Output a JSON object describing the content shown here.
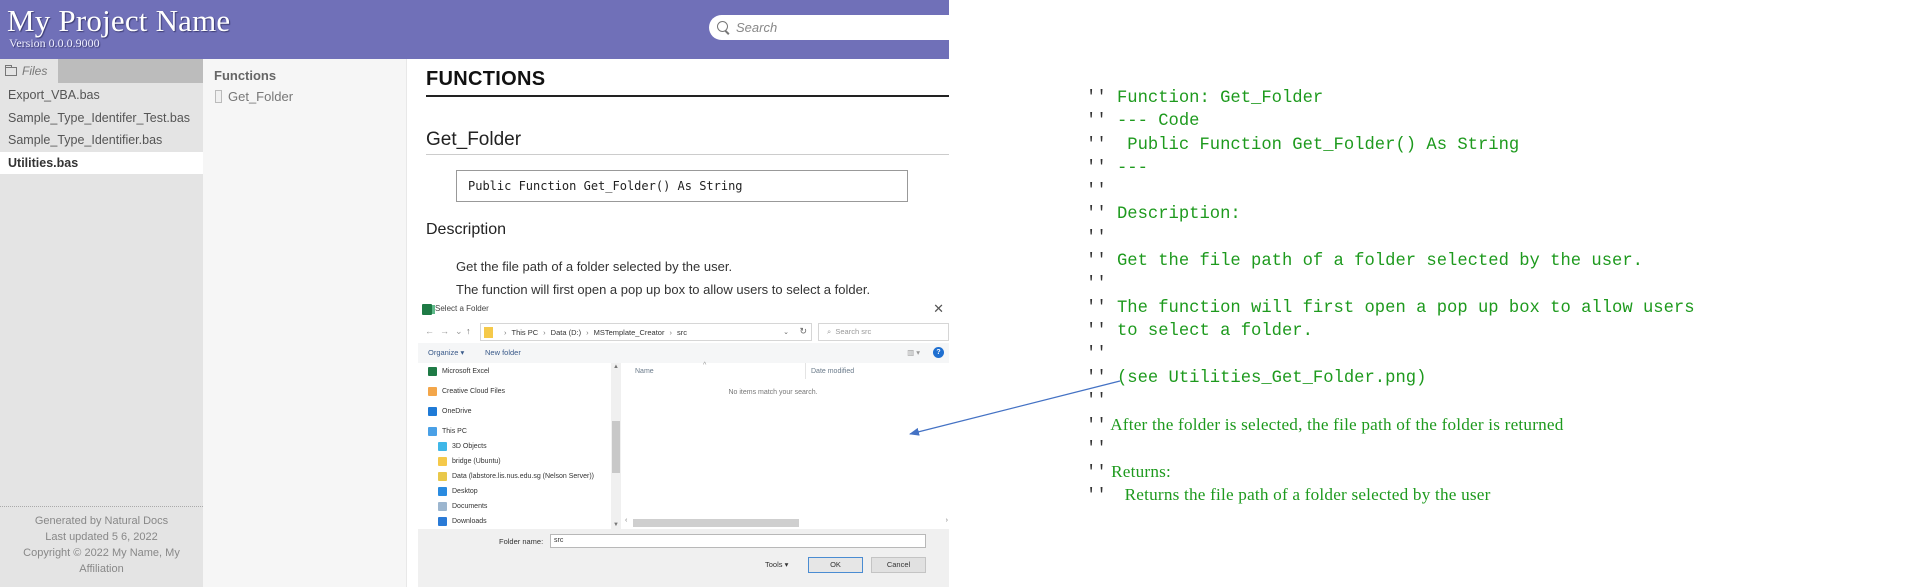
{
  "header": {
    "project_title": "My Project Name",
    "version": "Version 0.0.0.9000",
    "search_placeholder": "Search",
    "search_value": ""
  },
  "sidebar": {
    "tab_label": "Files",
    "files": [
      {
        "label": "Export_VBA.bas",
        "selected": false
      },
      {
        "label": "Sample_Type_Identifer_Test.bas",
        "selected": false
      },
      {
        "label": "Sample_Type_Identifier.bas",
        "selected": false
      },
      {
        "label": "Utilities.bas",
        "selected": true
      }
    ],
    "footer": {
      "generated_by": "Generated by Natural Docs",
      "last_updated": "Last updated 5 6, 2022",
      "copyright": "Copyright © 2022 My Name, My Affiliation"
    }
  },
  "summary": {
    "title": "Functions",
    "items": [
      "Get_Folder"
    ]
  },
  "content": {
    "section_title": "FUNCTIONS",
    "function_name": "Get_Folder",
    "prototype": "Public Function Get_Folder() As String",
    "description_heading": "Description",
    "description_paragraphs": [
      "Get the file path of a folder selected by the user.",
      "The function will first open a pop up box to allow users to select a folder."
    ],
    "dialog_image": {
      "title": "Select a Folder",
      "close": "✕",
      "nav": {
        "back": "←",
        "forward": "→",
        "recent": "⌄",
        "up": "↑"
      },
      "breadcrumb": [
        "This PC",
        "Data (D:)",
        "MSTemplate_Creator",
        "src"
      ],
      "address_dropdown": "⌄",
      "refresh": "↻",
      "search_placeholder": "Search src",
      "organize": "Organize ▾",
      "new_folder": "New folder",
      "view": "▥ ▾",
      "help": "?",
      "nav_items": [
        {
          "label": "Microsoft Excel",
          "icon": "excel-icon",
          "color": "#1e7a45"
        },
        {
          "label": "Creative Cloud Files",
          "icon": "creative-cloud-icon",
          "color": "#f3a64a"
        },
        {
          "label": "OneDrive",
          "icon": "onedrive-icon",
          "color": "#1f7ad6"
        },
        {
          "label": "This PC",
          "icon": "computer-icon",
          "color": "#4aa0e6"
        },
        {
          "label": "3D Objects",
          "icon": "3d-objects-icon",
          "color": "#3fb7e8"
        },
        {
          "label": "bridge (Ubuntu)",
          "icon": "folder-icon",
          "color": "#f5c94a"
        },
        {
          "label": "Data (labstore.lis.nus.edu.sg (Nelson Server))",
          "icon": "network-drive-icon",
          "color": "#e9c84a"
        },
        {
          "label": "Desktop",
          "icon": "desktop-icon",
          "color": "#2a8be0"
        },
        {
          "label": "Documents",
          "icon": "documents-icon",
          "color": "#9cb6cf"
        },
        {
          "label": "Downloads",
          "icon": "downloads-icon",
          "color": "#2a7ad6"
        }
      ],
      "column_name": "Name",
      "column_date": "Date modified",
      "empty_message": "No items match your search.",
      "folder_name_label": "Folder name:",
      "folder_name_value": "src",
      "tools": "Tools  ▾",
      "ok": "OK",
      "cancel": "Cancel"
    }
  },
  "code_comment": {
    "prefix": "''",
    "lines": [
      " Function: Get_Folder",
      " --- Code",
      "  Public Function Get_Folder() As String",
      " ---",
      "",
      " Description:",
      "",
      " Get the file path of a folder selected by the user.",
      "",
      " The function will first open a pop up box to allow users",
      " to select a folder.",
      "",
      " (see Utilities_Get_Folder.png)",
      "",
      " After the folder is selected, the file path of the folder is returned",
      "",
      " Returns:",
      "    Returns the file path of a folder selected by the user"
    ]
  },
  "colors": {
    "header_bg": "#7070b8",
    "comment_green": "#1e9a1e",
    "arrow_blue": "#4472c4"
  }
}
